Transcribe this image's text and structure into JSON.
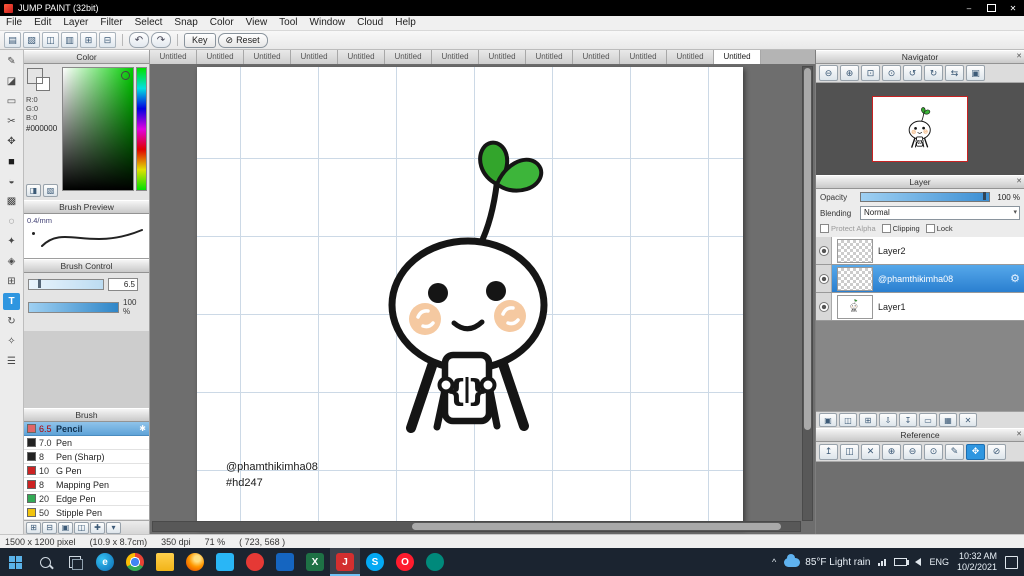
{
  "titlebar": {
    "title": "JUMP PAINT (32bit)",
    "minimize_glyph": "–",
    "close_glyph": "✕"
  },
  "menubar": {
    "items": [
      "File",
      "Edit",
      "Layer",
      "Filter",
      "Select",
      "Snap",
      "Color",
      "View",
      "Tool",
      "Window",
      "Cloud",
      "Help"
    ]
  },
  "toolbar": {
    "icons": [
      {
        "name": "new-file-icon",
        "glyph": "▤"
      },
      {
        "name": "open-file-icon",
        "glyph": "▨"
      },
      {
        "name": "save-icon",
        "glyph": "◫"
      },
      {
        "name": "export-icon",
        "glyph": "▥"
      },
      {
        "name": "grid-icon",
        "glyph": "⊞"
      },
      {
        "name": "snap-icon",
        "glyph": "⊟"
      }
    ],
    "undo_glyph": "↶",
    "redo_glyph": "↷",
    "key_label": "Key",
    "reset_label": "Reset",
    "reset_glyph": "⊘"
  },
  "tools": {
    "items": [
      {
        "name": "pen-tool",
        "glyph": "✎"
      },
      {
        "name": "eraser-tool",
        "glyph": "◪"
      },
      {
        "name": "marquee-tool",
        "glyph": "▭"
      },
      {
        "name": "lasso-tool",
        "glyph": "✂"
      },
      {
        "name": "move-tool",
        "glyph": "✥"
      },
      {
        "name": "fill-tool",
        "glyph": "■"
      },
      {
        "name": "bucket-tool",
        "glyph": "◒"
      },
      {
        "name": "gradient-tool",
        "glyph": "▩"
      },
      {
        "name": "dot-tool",
        "glyph": "◌"
      },
      {
        "name": "wand-tool",
        "glyph": "✦"
      },
      {
        "name": "stamp-tool",
        "glyph": "◈"
      },
      {
        "name": "divide-tool",
        "glyph": "⊞"
      },
      {
        "name": "text-tool",
        "glyph": "T"
      },
      {
        "name": "rotate-tool",
        "glyph": "↻"
      },
      {
        "name": "eyedropper-tool",
        "glyph": "✧"
      },
      {
        "name": "hand-tool",
        "glyph": "☰"
      }
    ]
  },
  "color_panel": {
    "title": "Color",
    "r": "R:0",
    "g": "G:0",
    "b": "B:0",
    "hex": "#000000",
    "current_color": "#000000",
    "hue_color": "#00cc00"
  },
  "brush_preview": {
    "title": "Brush Preview",
    "size_label": "0.4/mm"
  },
  "brush_control": {
    "title": "Brush Control",
    "size_value": "6.5",
    "opacity_value": "100 %"
  },
  "brush_panel": {
    "title": "Brush",
    "selected_glyph": "✱",
    "brushes": [
      {
        "size": "6.5",
        "name": "Pencil",
        "chip": "background:#e06666;border:1px solid #666;"
      },
      {
        "size": "7.0",
        "name": "Pen",
        "chip": "background:#222222;border:1px solid #666;"
      },
      {
        "size": "8",
        "name": "Pen (Sharp)",
        "chip": "background:#222222;border:1px solid #666;"
      },
      {
        "size": "10",
        "name": "G Pen",
        "chip": "background:#cc2222;border:1px solid #666;"
      },
      {
        "size": "8",
        "name": "Mapping Pen",
        "chip": "background:#cc2222;border:1px solid #666;"
      },
      {
        "size": "20",
        "name": "Edge Pen",
        "chip": "background:#33aa55;border:1px solid #666;"
      },
      {
        "size": "50",
        "name": "Stipple Pen",
        "chip": "background:#f1c40f;border:1px solid #666;"
      }
    ]
  },
  "brush_footer": {
    "icons": [
      {
        "name": "add-brush-icon",
        "glyph": "⊞"
      },
      {
        "name": "remove-brush-icon",
        "glyph": "⊟"
      },
      {
        "name": "edit-brush-icon",
        "glyph": "▣"
      },
      {
        "name": "folder-icon",
        "glyph": "◫"
      },
      {
        "name": "new-brush-icon",
        "glyph": "✚"
      },
      {
        "name": "menu-icon",
        "glyph": "▾"
      }
    ]
  },
  "canvas": {
    "tabs": [
      "Untitled",
      "Untitled",
      "Untitled",
      "Untitled",
      "Untitled",
      "Untitled",
      "Untitled",
      "Untitled",
      "Untitled",
      "Untitled",
      "Untitled",
      "Untitled",
      "Untitled"
    ],
    "annotation": {
      "line1": "@phamthikimha08",
      "line2": "#hd247"
    }
  },
  "navigator": {
    "title": "Navigator",
    "icons": [
      {
        "name": "zoom-out-icon",
        "glyph": "⊖"
      },
      {
        "name": "zoom-in-icon",
        "glyph": "⊕"
      },
      {
        "name": "zoom-fit-icon",
        "glyph": "⊡"
      },
      {
        "name": "zoom-actual-icon",
        "glyph": "⊙"
      },
      {
        "name": "rotate-left-icon",
        "glyph": "↺"
      },
      {
        "name": "rotate-right-icon",
        "glyph": "↻"
      },
      {
        "name": "flip-icon",
        "glyph": "⇆"
      },
      {
        "name": "reset-view-icon",
        "glyph": "▣"
      }
    ]
  },
  "layer_panel": {
    "title": "Layer",
    "opacity_label": "Opacity",
    "opacity_value": "100 %",
    "blending_label": "Blending",
    "blending_value": "Normal",
    "protect_alpha_label": "Protect Alpha",
    "clipping_label": "Clipping",
    "lock_label": "Lock",
    "layers": [
      {
        "name": "Layer2"
      },
      {
        "name": "@phamthikimha08"
      },
      {
        "name": "Layer1"
      }
    ],
    "buttons": [
      {
        "name": "new-layer-icon",
        "glyph": "▣"
      },
      {
        "name": "new-folder-icon",
        "glyph": "◫"
      },
      {
        "name": "duplicate-layer-icon",
        "glyph": "⊞"
      },
      {
        "name": "merge-down-icon",
        "glyph": "⇩"
      },
      {
        "name": "transfer-icon",
        "glyph": "↧"
      },
      {
        "name": "clear-layer-icon",
        "glyph": "▭"
      },
      {
        "name": "mask-icon",
        "glyph": "▦"
      },
      {
        "name": "delete-layer-icon",
        "glyph": "✕"
      }
    ]
  },
  "reference": {
    "title": "Reference",
    "icons": [
      {
        "name": "load-image-icon",
        "glyph": "↥"
      },
      {
        "name": "open-folder-icon",
        "glyph": "◫"
      },
      {
        "name": "clear-icon",
        "glyph": "✕"
      },
      {
        "name": "zoom-in-icon",
        "glyph": "⊕"
      },
      {
        "name": "zoom-out-icon",
        "glyph": "⊖"
      },
      {
        "name": "zoom-reset-icon",
        "glyph": "⊙"
      },
      {
        "name": "pick-icon",
        "glyph": "✎"
      },
      {
        "name": "pan-icon",
        "glyph": "✥"
      },
      {
        "name": "disable-icon",
        "glyph": "⊘"
      }
    ]
  },
  "status_bar": {
    "size_text": "1500 x 1200 pixel",
    "dims_text": "(10.9 x 8.7cm)",
    "dpi_text": "350 dpi",
    "zoom_text": "71 %",
    "coords_text": "( 723, 568 )"
  },
  "taskbar": {
    "apps": [
      {
        "name": "app-edge-icon",
        "glyph": "e",
        "style": "background:radial-gradient(circle at 35% 35%,#35c1f1,#0b6bb5);border-radius:50%;"
      },
      {
        "name": "app-chrome-icon",
        "glyph": "",
        "style": "background:radial-gradient(circle at 50% 50%,#4285f4 0 4px,#fff 4px 5px,transparent 5px),conic-gradient(#ea4335 0deg 120deg,#34a853 120deg 240deg,#fbbc05 240deg 360deg);border-radius:50%;"
      },
      {
        "name": "app-folder-icon",
        "glyph": "",
        "style": "background:linear-gradient(#ffd04c,#f2b418);border-radius:2px;"
      },
      {
        "name": "app-firefox-icon",
        "glyph": "",
        "style": "background:radial-gradient(circle at 62% 32%,#ffe082 0 18%,#ff9800 48%,#e65100 85%);border-radius:50%;"
      },
      {
        "name": "app-photos-icon",
        "glyph": "",
        "style": "background:#29b6f6;border-radius:3px;"
      },
      {
        "name": "app-red-icon",
        "glyph": "",
        "style": "background:#e53935;border-radius:50%;"
      },
      {
        "name": "app-blue-icon",
        "glyph": "",
        "style": "background:#1565c0;border-radius:3px;"
      },
      {
        "name": "app-excel-icon",
        "glyph": "X",
        "style": "background:#1e7145;border-radius:3px;"
      },
      {
        "name": "app-jump-paint-icon",
        "glyph": "J",
        "style": "background:#d32f2f;border-radius:3px;"
      },
      {
        "name": "app-skype-icon",
        "glyph": "S",
        "style": "background:#03a9f4;border-radius:50%;"
      },
      {
        "name": "app-opera-icon",
        "glyph": "O",
        "style": "background:#ff1b2d;border-radius:50%;"
      },
      {
        "name": "app-teams-icon",
        "glyph": "",
        "style": "background:#00897b;border-radius:50%;"
      }
    ],
    "weather": "85°F Light rain",
    "language": "ENG",
    "time": "10:32 AM",
    "date": "10/2/2021"
  },
  "ui": {
    "close_glyph": "✕",
    "dropdown_arrow": "▾",
    "gear_glyph": "⚙"
  },
  "colors": {
    "accent": "#2f96e0",
    "layer_selected": "#2a7fd0",
    "canvas_grid": "#ccd9e6",
    "navigator_border": "#c82222"
  }
}
